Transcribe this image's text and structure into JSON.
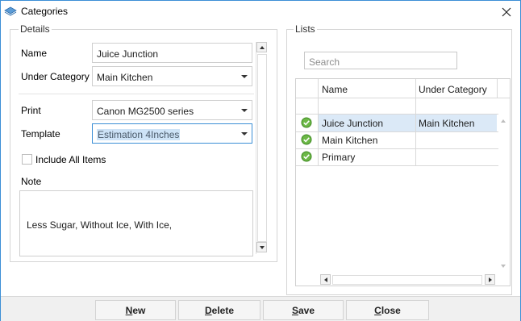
{
  "window": {
    "title": "Categories"
  },
  "details": {
    "legend": "Details",
    "name_label": "Name",
    "name_value": "Juice Junction",
    "under_category_label": "Under Category",
    "under_category_value": "Main Kitchen",
    "print_label": "Print",
    "print_value": "Canon MG2500 series",
    "template_label": "Template",
    "template_value": "Estimation 4Inches",
    "include_all_label": "Include All Items",
    "include_all_checked": false,
    "note_label": "Note",
    "note_value": "Less Sugar, Without Ice, With Ice,"
  },
  "lists": {
    "legend": "Lists",
    "search_placeholder": "Search",
    "columns": [
      "Name",
      "Under Category"
    ],
    "rows": [
      {
        "name": "Juice Junction",
        "under_category": "Main Kitchen",
        "selected": true
      },
      {
        "name": "Main Kitchen",
        "under_category": "",
        "selected": false
      },
      {
        "name": "Primary",
        "under_category": "",
        "selected": false
      }
    ]
  },
  "buttons": {
    "new_u": "N",
    "new_rest": "ew",
    "delete_u": "D",
    "delete_rest": "elete",
    "save_u": "S",
    "save_rest": "ave",
    "close_u": "C",
    "close_rest": "lose"
  },
  "colors": {
    "accent": "#3c8fd6",
    "selection": "#cde3f7",
    "check_green": "#5aa83a"
  }
}
